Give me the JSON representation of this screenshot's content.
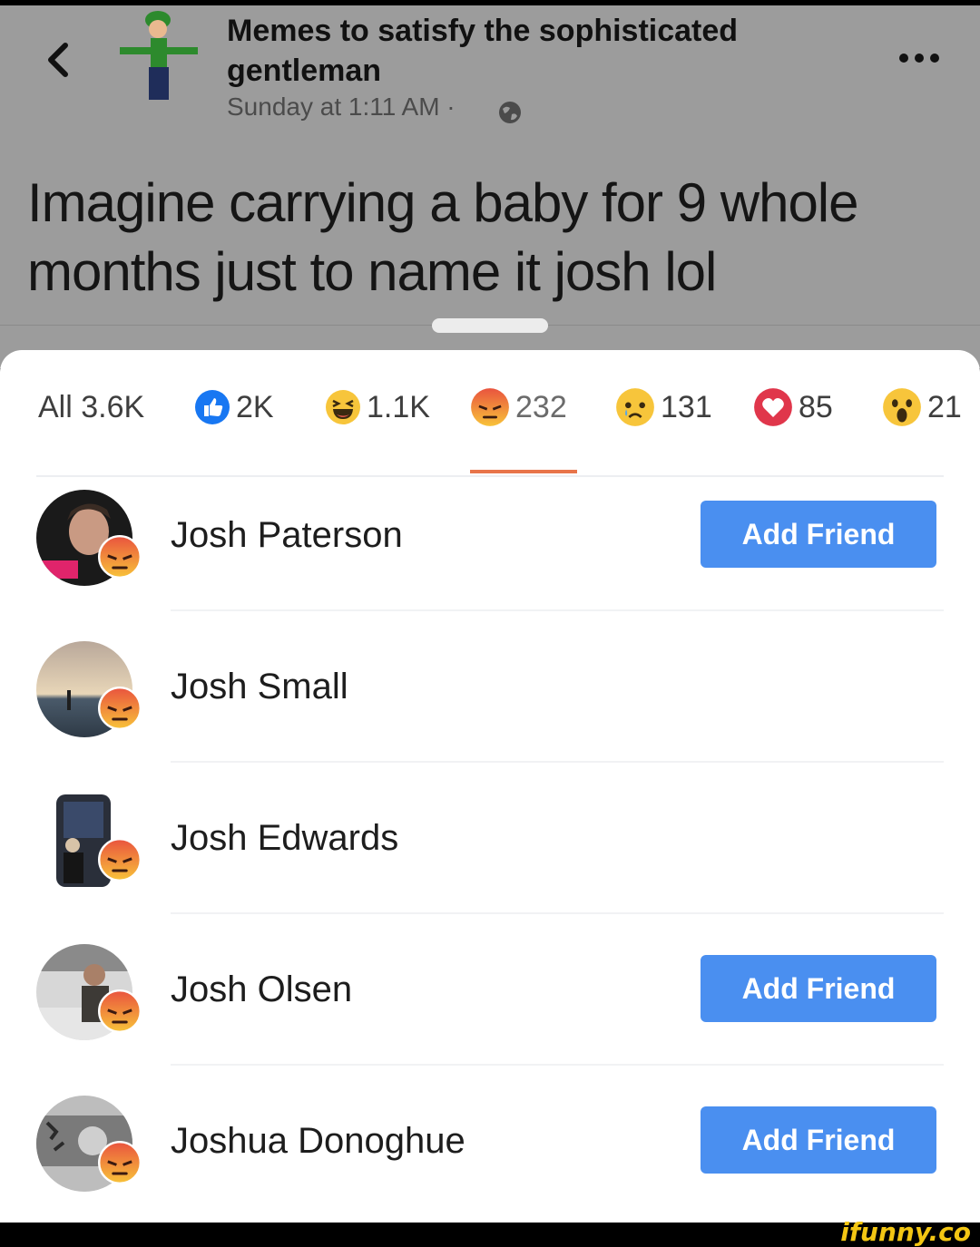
{
  "post": {
    "page_name": "Memes to satisfy the sophisticated gentleman",
    "time": "Sunday at 1:11 AM ·",
    "text": "Imagine carrying a baby for 9 whole months just to name it josh lol",
    "icons": {
      "back": "chevron-left-icon",
      "more": "more-dots-icon",
      "privacy": "globe-icon"
    }
  },
  "reactions": {
    "tabs": [
      {
        "id": "all",
        "label": "All 3.6K",
        "icon": "none"
      },
      {
        "id": "like",
        "label": "2K",
        "icon": "like-icon",
        "color": "#1877f2"
      },
      {
        "id": "haha",
        "label": "1.1K",
        "icon": "haha-icon",
        "color": "#f7c53b"
      },
      {
        "id": "angry",
        "label": "232",
        "icon": "angry-icon",
        "color": "#e8744a",
        "selected": true
      },
      {
        "id": "sad",
        "label": "131",
        "icon": "sad-icon",
        "color": "#f7c53b"
      },
      {
        "id": "love",
        "label": "85",
        "icon": "love-icon",
        "color": "#e0364b"
      },
      {
        "id": "wow",
        "label": "21",
        "icon": "wow-icon",
        "color": "#f7c53b"
      }
    ],
    "people": [
      {
        "name": "Josh Paterson",
        "button": "Add Friend",
        "reaction": "angry"
      },
      {
        "name": "Josh Small",
        "button": "",
        "reaction": "angry"
      },
      {
        "name": "Josh Edwards",
        "button": "",
        "reaction": "angry"
      },
      {
        "name": "Josh Olsen",
        "button": "Add Friend",
        "reaction": "angry"
      },
      {
        "name": "Joshua Donoghue",
        "button": "Add Friend",
        "reaction": "angry"
      }
    ]
  },
  "watermark": "ifunny.co"
}
